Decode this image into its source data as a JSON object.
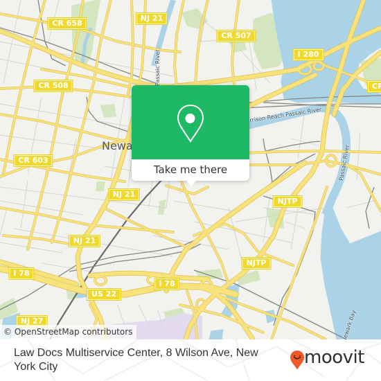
{
  "map": {
    "route_shields": [
      {
        "label": "CR 658"
      },
      {
        "label": "NJ 21"
      },
      {
        "label": "CR 507"
      },
      {
        "label": "I 280"
      },
      {
        "label": "CR 508"
      },
      {
        "label": "CR 603"
      },
      {
        "label": "NJ 21"
      },
      {
        "label": "NJTP"
      },
      {
        "label": "NJ 21"
      },
      {
        "label": "NJTP"
      },
      {
        "label": "I 78"
      },
      {
        "label": "US 22"
      },
      {
        "label": "I 78"
      },
      {
        "label": "NJ 27"
      },
      {
        "label": "CR"
      }
    ],
    "place_labels": {
      "city": "Newark",
      "passaic_river_north": "Passaic River",
      "harrison_reach": "Harrison Reach Passaic River",
      "passaic_river_south": "Passaic River",
      "newark_bay": "Newark Bay"
    },
    "attribution": "© OpenStreetMap contributors"
  },
  "popup": {
    "icon": "location-pin-icon",
    "button_label": "Take me there"
  },
  "footer": {
    "address": "Law Docs Multiservice Center, 8 Wilson Ave, New York City",
    "brand": "moovit",
    "brand_icon": "moovit-smile-pin-icon"
  },
  "colors": {
    "popup_green": "#1db964",
    "brand_orange": "#f05a28",
    "water": "#aad3e8",
    "major_road": "#f8e27c",
    "route_shield": "#f1d92b",
    "park": "#d3e6bf"
  }
}
